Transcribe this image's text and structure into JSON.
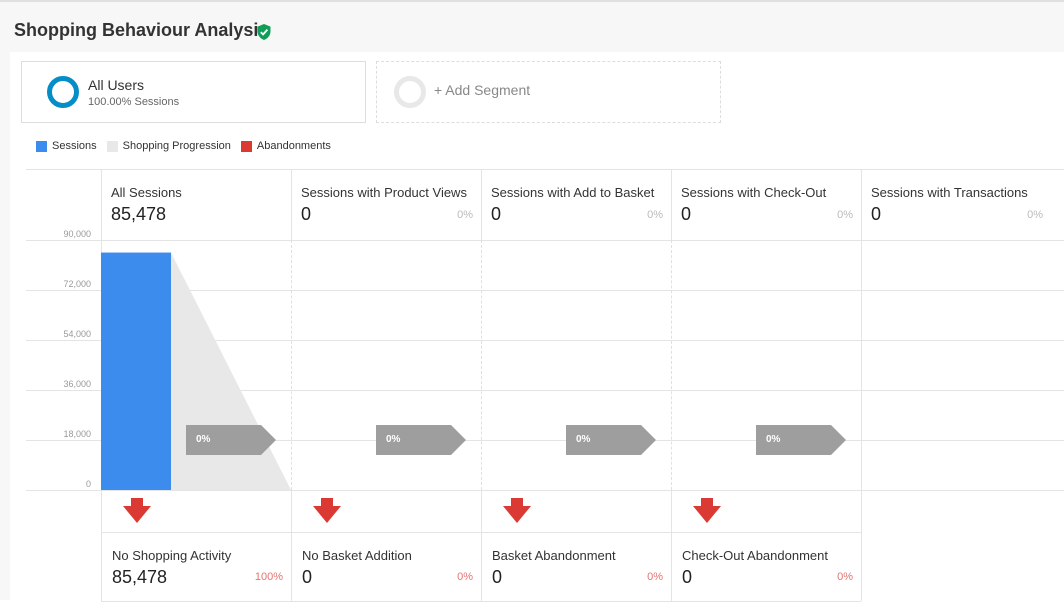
{
  "header": {
    "title": "Shopping Behaviour Analysis",
    "verified_icon": "verified-shield-icon",
    "verified_color": "#0f9d58"
  },
  "segments": {
    "active": {
      "name": "All Users",
      "detail": "100.00% Sessions",
      "color": "#058dc7"
    },
    "add_label": "+ Add Segment"
  },
  "legend": [
    {
      "label": "Sessions",
      "color": "#3b8ced"
    },
    {
      "label": "Shopping Progression",
      "color": "#e8e8e8"
    },
    {
      "label": "Abandonments",
      "color": "#db3a34"
    }
  ],
  "chart_data": {
    "type": "bar",
    "yticks": [
      "90,000",
      "72,000",
      "54,000",
      "36,000",
      "18,000",
      "0"
    ],
    "ylim": [
      0,
      90000
    ],
    "stages": [
      {
        "label": "All Sessions",
        "value": 85478,
        "display": "85,478",
        "pct": ""
      },
      {
        "label": "Sessions with Product Views",
        "value": 0,
        "display": "0",
        "pct": "0%"
      },
      {
        "label": "Sessions with Add to Basket",
        "value": 0,
        "display": "0",
        "pct": "0%"
      },
      {
        "label": "Sessions with Check-Out",
        "value": 0,
        "display": "0",
        "pct": "0%"
      },
      {
        "label": "Sessions with Transactions",
        "value": 0,
        "display": "0",
        "pct": "0%"
      }
    ],
    "progression_labels": [
      "0%",
      "0%",
      "0%",
      "0%"
    ],
    "abandonments": [
      {
        "label": "No Shopping Activity",
        "value": 85478,
        "display": "85,478",
        "pct": "100%"
      },
      {
        "label": "No Basket Addition",
        "value": 0,
        "display": "0",
        "pct": "0%"
      },
      {
        "label": "Basket Abandonment",
        "value": 0,
        "display": "0",
        "pct": "0%"
      },
      {
        "label": "Check-Out Abandonment",
        "value": 0,
        "display": "0",
        "pct": "0%"
      }
    ],
    "colors": {
      "sessions": "#3b8ced",
      "progression": "#e8e8e8",
      "abandonment": "#db3a34",
      "arrow": "#9e9e9e"
    }
  }
}
